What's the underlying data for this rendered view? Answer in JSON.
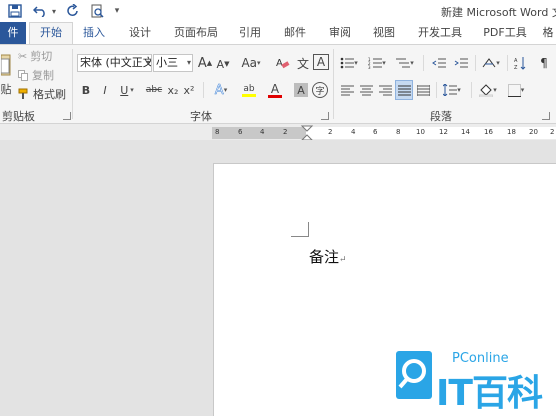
{
  "app": {
    "window_title": "新建 Microsoft Word 文",
    "quick_access": {
      "save": "save-icon",
      "undo": "undo-icon",
      "redo": "redo-icon",
      "preview": "print-preview-icon",
      "customize": "▾"
    }
  },
  "tabs": [
    {
      "label": "件",
      "state": "file"
    },
    {
      "label": "开始",
      "state": "active"
    },
    {
      "label": "插入",
      "state": "highlight"
    },
    {
      "label": "设计"
    },
    {
      "label": "页面布局"
    },
    {
      "label": "引用"
    },
    {
      "label": "邮件"
    },
    {
      "label": "审阅"
    },
    {
      "label": "视图"
    },
    {
      "label": "开发工具"
    },
    {
      "label": "PDF工具"
    },
    {
      "label": "格"
    }
  ],
  "clipboard": {
    "label": "剪贴板",
    "paste_partial": "贴",
    "cut": "剪切",
    "copy": "复制",
    "format_painter": "格式刷"
  },
  "font": {
    "label": "字体",
    "name": "宋体 (中文正文",
    "size": "小三",
    "grow": "A",
    "shrink": "A",
    "case": "Aa",
    "bold": "B",
    "italic": "I",
    "underline": "U",
    "strike": "abc",
    "subscript": "x₂",
    "superscript": "x²",
    "text_effect": "A",
    "highlight": "ab",
    "font_color": "A",
    "char_shading": "A",
    "enclose": "字",
    "phonetic": "文",
    "border_char": "A"
  },
  "paragraph": {
    "label": "段落"
  },
  "ruler": {
    "ticks": [
      "8",
      "6",
      "4",
      "2",
      "2",
      "4",
      "6",
      "8",
      "10",
      "12",
      "14",
      "16",
      "18",
      "20",
      "2"
    ]
  },
  "document": {
    "text": "备注",
    "para_mark": "↵"
  },
  "watermark": {
    "small": "PConline",
    "big": "IT百科"
  },
  "colors": {
    "file_tab": "#2b579a",
    "accent": "#2b579a",
    "highlight_yellow": "#ffff00",
    "font_red": "#e00000",
    "logo_blue": "#2aa5e6"
  }
}
